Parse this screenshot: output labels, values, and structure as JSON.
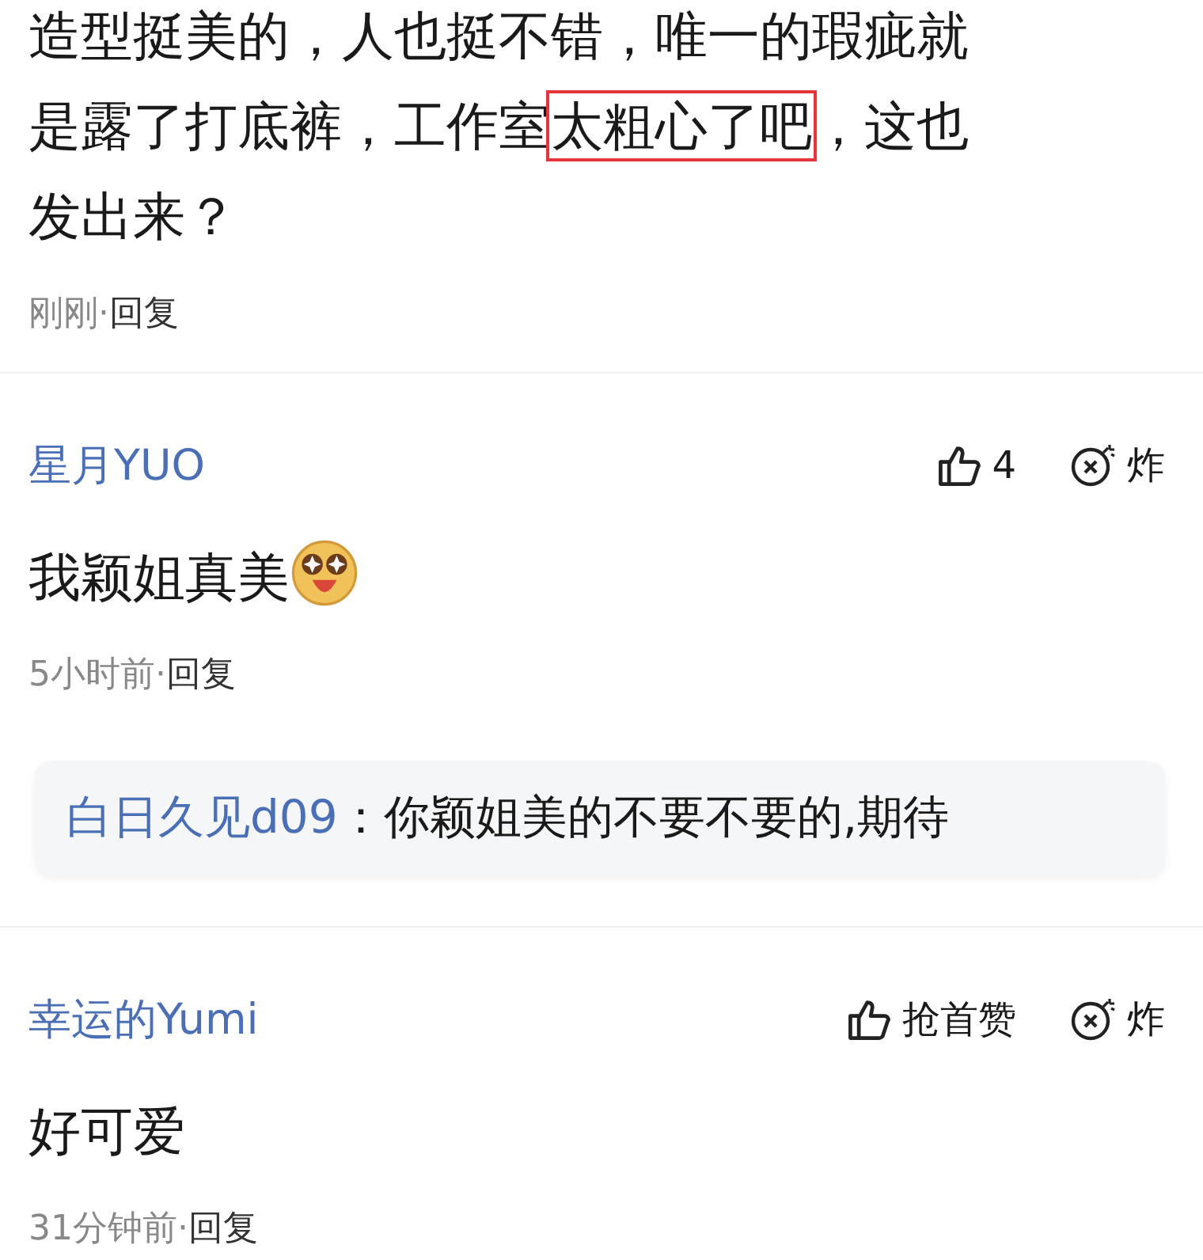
{
  "comments": [
    {
      "segments": [
        {
          "text": "造型挺美的，人也挺不错，唯一的瑕疵就是露了打底裤，工作室",
          "highlighted": false
        },
        {
          "text": "太粗心了吧",
          "highlighted": true
        },
        {
          "text": "，这也发出来？",
          "highlighted": false
        }
      ],
      "time": "刚刚·",
      "reply": "回复"
    },
    {
      "author": "星月YUO",
      "like": "4",
      "bomb": "炸",
      "text": "我颖姐真美",
      "emoji": true,
      "time": "5小时前·",
      "reply": "回复",
      "replies": [
        {
          "author": "白日久见d09",
          "text": "：你颖姐美的不要不要的,期待"
        }
      ]
    },
    {
      "author": "幸运的Yumi",
      "like": "抢首赞",
      "bomb": "炸",
      "text": "好可爱",
      "time": "31分钟前·",
      "reply": "回复"
    }
  ]
}
